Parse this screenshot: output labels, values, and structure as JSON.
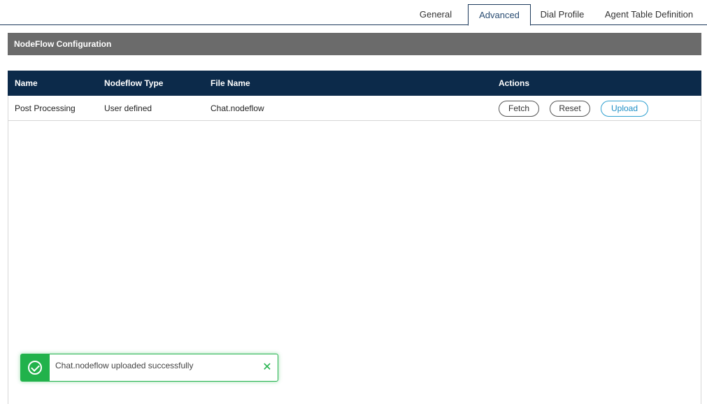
{
  "tabs": [
    {
      "label": "General",
      "active": false
    },
    {
      "label": "Advanced",
      "active": true
    },
    {
      "label": "Dial Profile",
      "active": false
    },
    {
      "label": "Agent Table Definition",
      "active": false
    }
  ],
  "section": {
    "title": "NodeFlow Configuration"
  },
  "table": {
    "headers": {
      "name": "Name",
      "type": "Nodeflow Type",
      "file": "File Name",
      "actions": "Actions"
    },
    "rows": [
      {
        "name": "Post Processing",
        "type": "User defined",
        "file": "Chat.nodeflow"
      }
    ],
    "actions": {
      "fetch": "Fetch",
      "reset": "Reset",
      "upload": "Upload"
    }
  },
  "toast": {
    "message": "Chat.nodeflow uploaded successfully",
    "icon": "check-circle-icon",
    "close_icon": "close-icon",
    "close_glyph": "✕",
    "color": "#21b24b"
  },
  "colors": {
    "header_bg": "#0c2a4a",
    "section_bg": "#6b6b6b",
    "upload_accent": "#1f8fc6"
  }
}
